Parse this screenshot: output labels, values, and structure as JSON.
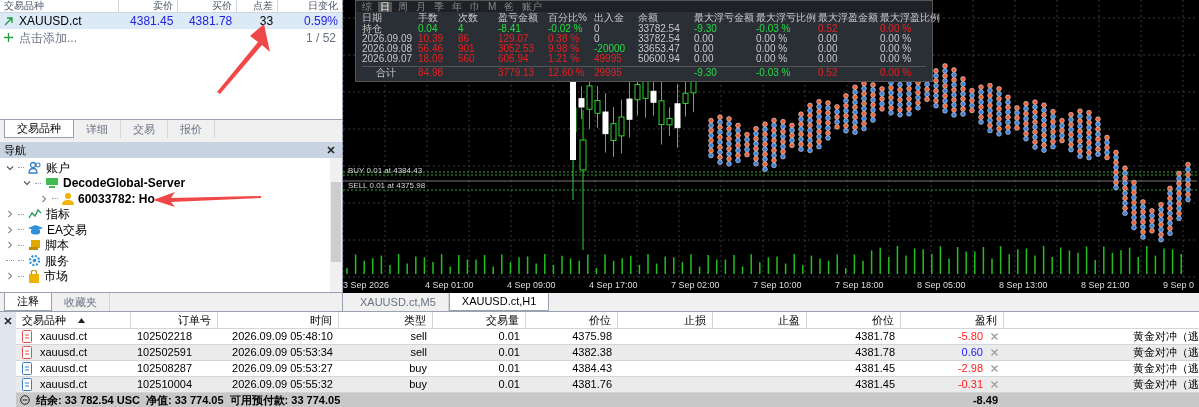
{
  "market_watch": {
    "columns": [
      "交易品种",
      "卖价",
      "买价",
      "点差",
      "日变化"
    ],
    "rows": [
      {
        "symbol": "XAUUSD.ct",
        "bid": "4381.45",
        "ask": "4381.78",
        "spread": "33",
        "change": "0.59%",
        "selected": true
      }
    ],
    "add_label": "点击添加...",
    "count": "1 / 52"
  },
  "left_tabs": [
    {
      "label": "交易品种",
      "selected": true
    },
    {
      "label": "详细",
      "selected": false
    },
    {
      "label": "交易",
      "selected": false
    },
    {
      "label": "报价",
      "selected": false
    }
  ],
  "navigator": {
    "title": "导航",
    "items": [
      {
        "label": "账户",
        "kind": "accounts",
        "leaf": false,
        "expanded": true,
        "children": [
          {
            "label": "DecodeGlobal-Server",
            "kind": "server",
            "leaf": false,
            "expanded": true,
            "children": [
              {
                "label": "60033782: Ho",
                "kind": "user",
                "leaf": false,
                "expanded": false
              }
            ]
          }
        ]
      },
      {
        "label": "指标",
        "kind": "indicator",
        "leaf": false,
        "expanded": false
      },
      {
        "label": "EA交易",
        "kind": "expert",
        "leaf": false,
        "expanded": false
      },
      {
        "label": "脚本",
        "kind": "script",
        "leaf": false,
        "expanded": false
      },
      {
        "label": "服务",
        "kind": "service",
        "leaf": true,
        "expanded": false
      },
      {
        "label": "市场",
        "kind": "market",
        "leaf": false,
        "expanded": false
      }
    ]
  },
  "navigator_tabs": [
    {
      "label": "注释",
      "selected": true
    },
    {
      "label": "收藏夹",
      "selected": false
    }
  ],
  "chart": {
    "period_buttons": [
      {
        "label": "综",
        "selected": false
      },
      {
        "label": "日",
        "selected": true
      },
      {
        "label": "周",
        "selected": false
      },
      {
        "label": "月",
        "selected": false
      },
      {
        "label": "季",
        "selected": false
      },
      {
        "label": "年",
        "selected": false
      },
      {
        "label": "巾",
        "selected": false
      },
      {
        "label": "M",
        "selected": false
      },
      {
        "label": "爸",
        "selected": false
      },
      {
        "label": "账户",
        "selected": false
      }
    ],
    "stats": {
      "columns": [
        "日期",
        "手数",
        "次数",
        "盈亏金额",
        "百分比%",
        "出入金",
        "余额",
        "最大浮亏金额",
        "最大浮亏比例",
        "最大浮盈金额",
        "最大浮盈比例"
      ],
      "rows": [
        {
          "kind": "row",
          "cells": [
            {
              "text": "持仓",
              "kind": "plain"
            },
            {
              "text": "0.04",
              "kind": "up"
            },
            {
              "text": "4",
              "kind": "up"
            },
            {
              "text": "-8.41",
              "kind": "up"
            },
            {
              "text": "-0.02 %",
              "kind": "up"
            },
            {
              "text": "0",
              "kind": "plain"
            },
            {
              "text": "33782.54",
              "kind": "plain"
            },
            {
              "text": "-9.30",
              "kind": "up"
            },
            {
              "text": "-0.03 %",
              "kind": "up"
            },
            {
              "text": "0.52",
              "kind": "down"
            },
            {
              "text": "0.00 %",
              "kind": "down"
            }
          ]
        },
        {
          "kind": "row",
          "cells": [
            {
              "text": "2026.09.09",
              "kind": "plain"
            },
            {
              "text": "10.39",
              "kind": "down"
            },
            {
              "text": "86",
              "kind": "down"
            },
            {
              "text": "129.07",
              "kind": "down"
            },
            {
              "text": "0.38 %",
              "kind": "down"
            },
            {
              "text": "0",
              "kind": "plain"
            },
            {
              "text": "33782.54",
              "kind": "plain"
            },
            {
              "text": "0.00",
              "kind": "plain"
            },
            {
              "text": "0.00 %",
              "kind": "plain"
            },
            {
              "text": "0.00",
              "kind": "plain"
            },
            {
              "text": "0.00 %",
              "kind": "plain"
            }
          ]
        },
        {
          "kind": "row",
          "cells": [
            {
              "text": "2026.09.08",
              "kind": "plain"
            },
            {
              "text": "56.46",
              "kind": "down"
            },
            {
              "text": "901",
              "kind": "down"
            },
            {
              "text": "3052.53",
              "kind": "down"
            },
            {
              "text": "9.98 %",
              "kind": "down"
            },
            {
              "text": "-20000",
              "kind": "up"
            },
            {
              "text": "33653.47",
              "kind": "plain"
            },
            {
              "text": "0.00",
              "kind": "plain"
            },
            {
              "text": "0.00 %",
              "kind": "plain"
            },
            {
              "text": "0.00",
              "kind": "plain"
            },
            {
              "text": "0.00 %",
              "kind": "plain"
            }
          ]
        },
        {
          "kind": "row",
          "cells": [
            {
              "text": "2026.09.07",
              "kind": "plain"
            },
            {
              "text": "18.09",
              "kind": "down"
            },
            {
              "text": "560",
              "kind": "down"
            },
            {
              "text": "605.94",
              "kind": "down"
            },
            {
              "text": "1.21 %",
              "kind": "down"
            },
            {
              "text": "49995",
              "kind": "down"
            },
            {
              "text": "50600.94",
              "kind": "plain"
            },
            {
              "text": "0.00",
              "kind": "plain"
            },
            {
              "text": "0.00 %",
              "kind": "plain"
            },
            {
              "text": "0.00",
              "kind": "plain"
            },
            {
              "text": "0.00 %",
              "kind": "plain"
            }
          ]
        },
        {
          "kind": "total",
          "cells": [
            {
              "text": "合计",
              "kind": "plain"
            },
            {
              "text": "84.98",
              "kind": "down"
            },
            null,
            {
              "text": "3779.13",
              "kind": "down"
            },
            {
              "text": "12.60 %",
              "kind": "down"
            },
            {
              "text": "29995",
              "kind": "down"
            },
            null,
            {
              "text": "-9.30",
              "kind": "up"
            },
            {
              "text": "-0.03 %",
              "kind": "up"
            },
            {
              "text": "0.52",
              "kind": "down"
            },
            {
              "text": "0.00 %",
              "kind": "down"
            }
          ]
        }
      ]
    },
    "order_labels": [
      "BUY 0.01 at 4384.43",
      "SELL 0.01 at 4375.98"
    ],
    "time_labels": [
      "3 Sep 2026",
      "4 Sep 01:00",
      "4 Sep 09:00",
      "4 Sep 17:00",
      "7 Sep 02:00",
      "7 Sep 10:00",
      "7 Sep 18:00",
      "8 Sep 05:00",
      "8 Sep 13:00",
      "8 Sep 21:00",
      "9 Sep 0"
    ]
  },
  "chart_tabs": [
    {
      "label": "XAUUSD.ct,M5",
      "selected": false
    },
    {
      "label": "XAUUSD.ct,H1",
      "selected": true
    }
  ],
  "trade": {
    "columns": [
      "交易品种",
      "订单号",
      "时间",
      "类型",
      "交易量",
      "价位",
      "止损",
      "止盈",
      "价位",
      "盈利"
    ],
    "rows": [
      {
        "kind": "sell",
        "symbol": "xauusd.ct",
        "order": "102502218",
        "time": "2026.09.09 05:48:10",
        "type": "sell",
        "volume": "0.01",
        "open_price": "4375.98",
        "price": "4381.78",
        "profit": {
          "text": "-5.80",
          "kind": "loss"
        },
        "comment": "黄金对冲（逃"
      },
      {
        "kind": "sell",
        "symbol": "xauusd.ct",
        "order": "102502591",
        "time": "2026.09.09 05:53:34",
        "type": "sell",
        "volume": "0.01",
        "open_price": "4382.38",
        "price": "4381.78",
        "profit": {
          "text": "0.60",
          "kind": "gain"
        },
        "comment": "黄金对冲（逃"
      },
      {
        "kind": "buy",
        "symbol": "xauusd.ct",
        "order": "102508287",
        "time": "2026.09.09 05:53:27",
        "type": "buy",
        "volume": "0.01",
        "open_price": "4384.43",
        "price": "4381.45",
        "profit": {
          "text": "-2.98",
          "kind": "loss"
        },
        "comment": "黄金对冲（逃"
      },
      {
        "kind": "buy",
        "symbol": "xauusd.ct",
        "order": "102510004",
        "time": "2026.09.09 05:55:32",
        "type": "buy",
        "volume": "0.01",
        "open_price": "4381.76",
        "price": "4381.45",
        "profit": {
          "text": "-0.31",
          "kind": "loss"
        },
        "comment": "黄金对冲（逃"
      }
    ],
    "summary": {
      "balance": "结余: 33 782.54 USC",
      "equity": "净值: 33 774.05",
      "free_margin": "可用预付款: 33 774.05",
      "profit": "-8.49"
    }
  }
}
